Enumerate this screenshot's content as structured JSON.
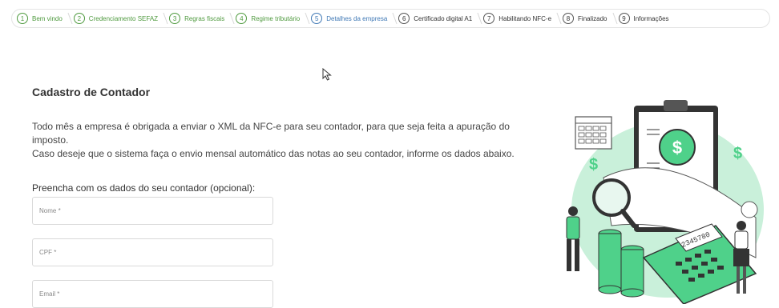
{
  "stepper": {
    "steps": [
      {
        "num": "1",
        "label": "Bem vindo",
        "state": "done"
      },
      {
        "num": "2",
        "label": "Credenciamento SEFAZ",
        "state": "done"
      },
      {
        "num": "3",
        "label": "Regras fiscais",
        "state": "done"
      },
      {
        "num": "4",
        "label": "Regime tributário",
        "state": "done"
      },
      {
        "num": "5",
        "label": "Detalhes da empresa",
        "state": "active"
      },
      {
        "num": "6",
        "label": "Certificado digital A1",
        "state": "todo"
      },
      {
        "num": "7",
        "label": "Habilitando NFC-e",
        "state": "todo"
      },
      {
        "num": "8",
        "label": "Finalizado",
        "state": "todo"
      },
      {
        "num": "9",
        "label": "Informações",
        "state": "todo"
      }
    ]
  },
  "main": {
    "title": "Cadastro de Contador",
    "description_line1": "Todo mês a empresa é obrigada a enviar o XML da NFC-e para seu contador, para que seja feita a apuração do imposto.",
    "description_line2": "Caso deseje que o sistema faça o envio mensal automático das notas ao seu contador, informe os dados abaixo.",
    "form_label": "Preencha com os dados do seu contador (opcional):",
    "fields": {
      "name": {
        "placeholder": "Nome *",
        "value": ""
      },
      "cpf": {
        "placeholder": "CPF *",
        "value": ""
      },
      "email": {
        "placeholder": "Email *",
        "value": ""
      }
    }
  },
  "illustration": {
    "calculator_display": "2345780",
    "currency_symbol": "$"
  },
  "colors": {
    "done": "#4f9a3f",
    "active": "#3f78b5",
    "illustration_green": "#4fd18a"
  }
}
